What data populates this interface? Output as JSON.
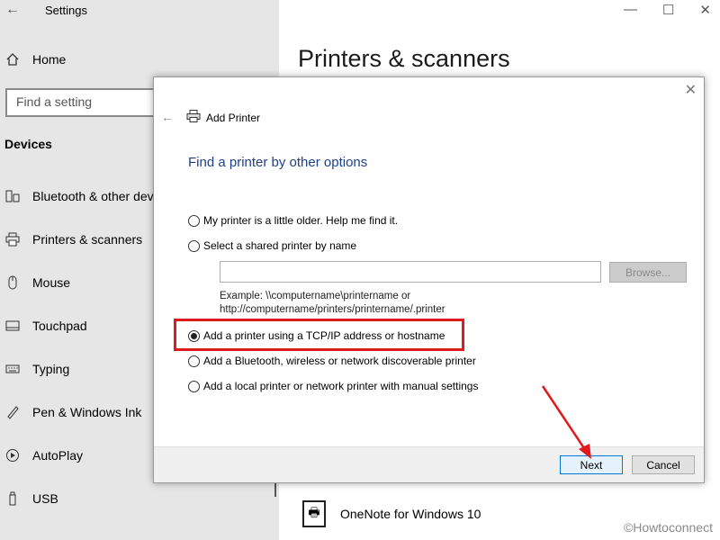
{
  "settings": {
    "title": "Settings",
    "home_label": "Home",
    "search_placeholder": "Find a setting",
    "section": "Devices",
    "nav": [
      {
        "label": "Bluetooth & other dev",
        "icon": "bluetooth-devices-icon"
      },
      {
        "label": "Printers & scanners",
        "icon": "printer-icon"
      },
      {
        "label": "Mouse",
        "icon": "mouse-icon"
      },
      {
        "label": "Touchpad",
        "icon": "touchpad-icon"
      },
      {
        "label": "Typing",
        "icon": "keyboard-icon"
      },
      {
        "label": "Pen & Windows Ink",
        "icon": "pen-icon"
      },
      {
        "label": "AutoPlay",
        "icon": "autoplay-icon"
      },
      {
        "label": "USB",
        "icon": "usb-icon"
      }
    ]
  },
  "main": {
    "heading": "Printers & scanners",
    "onenote_label": "OneNote for Windows 10",
    "watermark": "©Howtoconnect"
  },
  "dialog": {
    "title": "Add Printer",
    "heading": "Find a printer by other options",
    "options": [
      {
        "label": "My printer is a little older. Help me find it.",
        "checked": false
      },
      {
        "label": "Select a shared printer by name",
        "checked": false
      },
      {
        "label": "Add a printer using a TCP/IP address or hostname",
        "checked": true
      },
      {
        "label": "Add a Bluetooth, wireless or network discoverable printer",
        "checked": false
      },
      {
        "label": "Add a local printer or network printer with manual settings",
        "checked": false
      }
    ],
    "browse_label": "Browse...",
    "example_line1": "Example: \\\\computername\\printername or",
    "example_line2": "http://computername/printers/printername/.printer",
    "next_label": "Next",
    "cancel_label": "Cancel"
  },
  "colors": {
    "accent": "#0078d7",
    "heading_blue": "#1e3f8c",
    "annotation_red": "#e0191c"
  }
}
